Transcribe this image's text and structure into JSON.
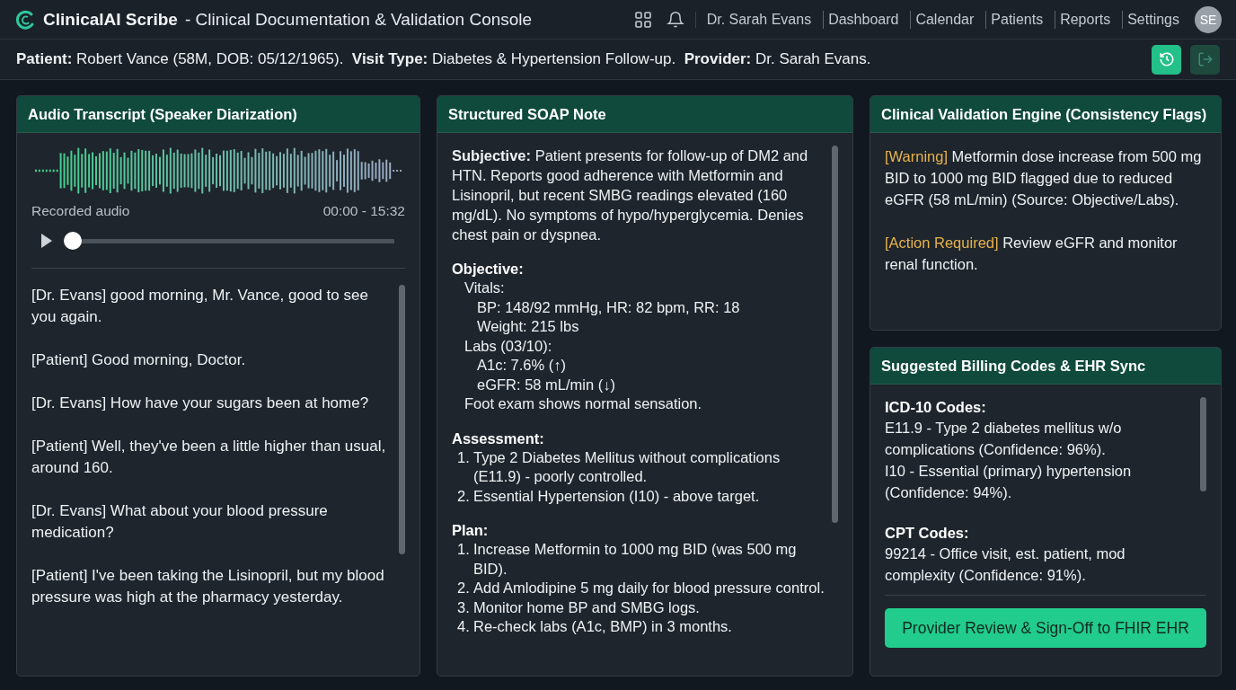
{
  "app": {
    "name": "ClinicalAI Scribe",
    "subtitle": "- Clinical Documentation & Validation Console",
    "user": "Dr. Sarah Evans",
    "nav": [
      {
        "label": "Dashboard"
      },
      {
        "label": "Calendar"
      },
      {
        "label": "Patients"
      },
      {
        "label": "Reports"
      },
      {
        "label": "Settings"
      }
    ],
    "avatar": "SE"
  },
  "patient_bar": {
    "text": "**Patient:** Robert Vance (58M, DOB: 05/12/1965).  **Visit Type:** Diabetes & Hypertension Follow-up.  **Provider:** Dr. Sarah Evans.",
    "buttons": [
      {
        "kind": "history",
        "disabled": false
      },
      {
        "kind": "logout",
        "disabled": true
      }
    ]
  },
  "transcript": {
    "title": "Audio Transcript (Speaker Diarization)",
    "audio_label": "Recorded audio",
    "time": "00:00 - 15:32",
    "playback": {
      "level": 0.0
    },
    "lines": [
      {
        "text": "[Dr. Evans] good morning, Mr. Vance, good to see you again."
      },
      {
        "text": "[Patient] Good morning, Doctor."
      },
      {
        "text": "[Dr. Evans] How have your sugars been at home?"
      },
      {
        "text": "[Patient] Well, they've been a little higher than usual, around 160."
      },
      {
        "text": "[Dr. Evans] What about your blood pressure medication?"
      },
      {
        "text": "[Patient] I've been taking the Lisinopril, but my blood pressure was high at the pharmacy yesterday."
      }
    ]
  },
  "soap": {
    "title": "Structured SOAP Note",
    "sections": [
      {
        "kind": "paragraph",
        "heading": "Subjective:",
        "text": "Patient presents for follow-up of DM2 and HTN. Reports good adherence with Metformin and Lisinopril, but recent SMBG readings elevated (160 mg/dL). No symptoms of hypo/hyperglycemia. Denies chest pain or dyspnea."
      },
      {
        "kind": "tree",
        "heading": "Objective:",
        "items": [
          {
            "text": "Vitals:",
            "children": [
              {
                "text": "BP: 148/92 mmHg, HR: 82 bpm, RR: 18"
              },
              {
                "text": "Weight: 215 lbs"
              }
            ]
          },
          {
            "text": "Labs (03/10):",
            "children": [
              {
                "text": "A1c: 7.6% (↑)"
              },
              {
                "text": "eGFR: 58 mL/min (↓)"
              }
            ]
          },
          {
            "text": "Foot exam shows normal sensation."
          }
        ]
      },
      {
        "kind": "numbered",
        "heading": "Assessment:",
        "items": [
          {
            "number": "1.",
            "text": "Type 2 Diabetes Mellitus without complications (E11.9) - poorly controlled."
          },
          {
            "number": "2.",
            "text": "Essential Hypertension (I10) - above target."
          }
        ]
      },
      {
        "kind": "numbered",
        "heading": "Plan:",
        "items": [
          {
            "number": "1.",
            "text": "Increase Metformin to 1000 mg BID (was 500 mg BID)."
          },
          {
            "number": "2.",
            "text": "Add Amlodipine 5 mg daily for blood pressure control."
          },
          {
            "number": "3.",
            "text": "Monitor home BP and SMBG logs."
          },
          {
            "number": "4.",
            "text": "Re-check labs (A1c, BMP) in 3 months."
          }
        ]
      }
    ]
  },
  "validation": {
    "title": "Clinical Validation Engine (Consistency Flags)",
    "flags": [
      {
        "tag": "[Warning]",
        "text": "Metformin dose increase from 500 mg BID to 1000 mg BID flagged due to reduced eGFR (58 mL/min) (Source: Objective/Labs)."
      },
      {
        "tag": "[Action Required]",
        "text": "Review eGFR and monitor renal function."
      }
    ]
  },
  "billing": {
    "title": "Suggested Billing Codes & EHR Sync",
    "groups": [
      {
        "heading": "ICD-10 Codes:",
        "codes": [
          "E11.9 - Type 2 diabetes mellitus w/o complications (Confidence: 96%).",
          "I10 - Essential (primary) hypertension (Confidence: 94%)."
        ]
      },
      {
        "heading": "CPT Codes:",
        "codes": [
          "99214 - Office visit, est. patient, mod complexity (Confidence: 91%)."
        ]
      }
    ],
    "button": "Provider Review & Sign-Off to FHIR EHR"
  }
}
